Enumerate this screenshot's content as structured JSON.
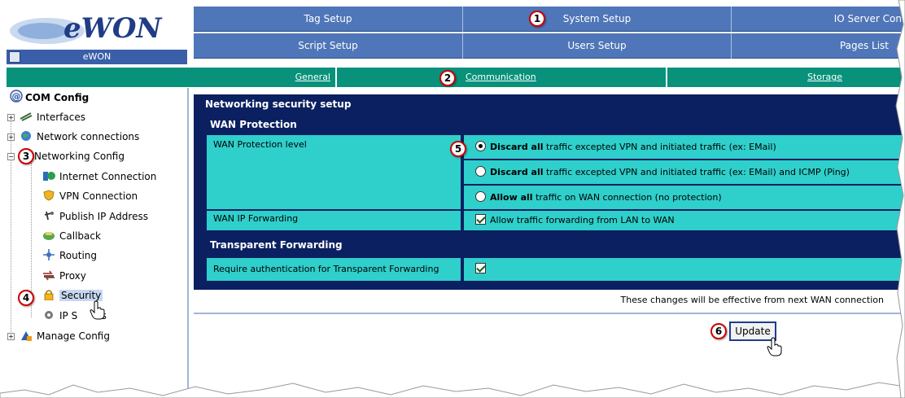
{
  "brand": {
    "logo_text": "eWON",
    "bar_label": "eWON"
  },
  "top_menu": {
    "row1": [
      "Tag Setup",
      "System Setup",
      "IO Server Con"
    ],
    "row2": [
      "Script Setup",
      "Users Setup",
      "Pages List"
    ]
  },
  "sub_tabs": [
    "General",
    "Communication",
    "Storage"
  ],
  "tree": {
    "root": "COM Config",
    "items": [
      "Interfaces",
      "Network connections",
      "Networking Config",
      "Internet Connection",
      "VPN Connection",
      "Publish IP Address",
      "Callback",
      "Routing",
      "Proxy",
      "Security",
      "IP Services",
      "Manage Config"
    ],
    "ip_services_fragment_a": "IP S",
    "ip_services_fragment_b": "es"
  },
  "panel": {
    "title": "Networking security setup",
    "wan_section": "WAN Protection",
    "wan_level_label": "WAN Protection level",
    "options": [
      {
        "bold": "Discard all",
        "text": " traffic excepted VPN and initiated traffic (ex: EMail)",
        "selected": true
      },
      {
        "bold": "Discard all",
        "text": " traffic excepted VPN and initiated traffic (ex: EMail) and ICMP (Ping)",
        "selected": false
      },
      {
        "bold": "Allow all",
        "text": " traffic on WAN connection (no protection)",
        "selected": false
      }
    ],
    "wan_ip_fwd_label": "WAN IP Forwarding",
    "wan_ip_fwd_value": "Allow traffic forwarding from LAN to WAN",
    "transparent_section": "Transparent Forwarding",
    "transparent_label": "Require authentication for Transparent Forwarding"
  },
  "note": "These changes will be effective from next WAN connection",
  "update_label": "Update",
  "callouts": [
    "1",
    "2",
    "3",
    "4",
    "5",
    "6"
  ],
  "colors": {
    "menu_blue": "#4f76b8",
    "tab_green": "#08917b",
    "panel_navy": "#0b2060",
    "row_cyan": "#2fcfcb",
    "callout_red": "#cc0000"
  }
}
